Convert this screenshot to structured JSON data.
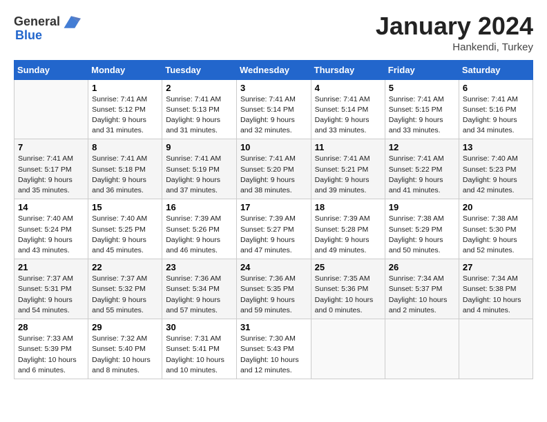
{
  "header": {
    "logo_general": "General",
    "logo_blue": "Blue",
    "month_title": "January 2024",
    "subtitle": "Hankendi, Turkey"
  },
  "columns": [
    "Sunday",
    "Monday",
    "Tuesday",
    "Wednesday",
    "Thursday",
    "Friday",
    "Saturday"
  ],
  "weeks": [
    [
      {
        "day": "",
        "sunrise": "",
        "sunset": "",
        "daylight": ""
      },
      {
        "day": "1",
        "sunrise": "Sunrise: 7:41 AM",
        "sunset": "Sunset: 5:12 PM",
        "daylight": "Daylight: 9 hours and 31 minutes."
      },
      {
        "day": "2",
        "sunrise": "Sunrise: 7:41 AM",
        "sunset": "Sunset: 5:13 PM",
        "daylight": "Daylight: 9 hours and 31 minutes."
      },
      {
        "day": "3",
        "sunrise": "Sunrise: 7:41 AM",
        "sunset": "Sunset: 5:14 PM",
        "daylight": "Daylight: 9 hours and 32 minutes."
      },
      {
        "day": "4",
        "sunrise": "Sunrise: 7:41 AM",
        "sunset": "Sunset: 5:14 PM",
        "daylight": "Daylight: 9 hours and 33 minutes."
      },
      {
        "day": "5",
        "sunrise": "Sunrise: 7:41 AM",
        "sunset": "Sunset: 5:15 PM",
        "daylight": "Daylight: 9 hours and 33 minutes."
      },
      {
        "day": "6",
        "sunrise": "Sunrise: 7:41 AM",
        "sunset": "Sunset: 5:16 PM",
        "daylight": "Daylight: 9 hours and 34 minutes."
      }
    ],
    [
      {
        "day": "7",
        "sunrise": "Sunrise: 7:41 AM",
        "sunset": "Sunset: 5:17 PM",
        "daylight": "Daylight: 9 hours and 35 minutes."
      },
      {
        "day": "8",
        "sunrise": "Sunrise: 7:41 AM",
        "sunset": "Sunset: 5:18 PM",
        "daylight": "Daylight: 9 hours and 36 minutes."
      },
      {
        "day": "9",
        "sunrise": "Sunrise: 7:41 AM",
        "sunset": "Sunset: 5:19 PM",
        "daylight": "Daylight: 9 hours and 37 minutes."
      },
      {
        "day": "10",
        "sunrise": "Sunrise: 7:41 AM",
        "sunset": "Sunset: 5:20 PM",
        "daylight": "Daylight: 9 hours and 38 minutes."
      },
      {
        "day": "11",
        "sunrise": "Sunrise: 7:41 AM",
        "sunset": "Sunset: 5:21 PM",
        "daylight": "Daylight: 9 hours and 39 minutes."
      },
      {
        "day": "12",
        "sunrise": "Sunrise: 7:41 AM",
        "sunset": "Sunset: 5:22 PM",
        "daylight": "Daylight: 9 hours and 41 minutes."
      },
      {
        "day": "13",
        "sunrise": "Sunrise: 7:40 AM",
        "sunset": "Sunset: 5:23 PM",
        "daylight": "Daylight: 9 hours and 42 minutes."
      }
    ],
    [
      {
        "day": "14",
        "sunrise": "Sunrise: 7:40 AM",
        "sunset": "Sunset: 5:24 PM",
        "daylight": "Daylight: 9 hours and 43 minutes."
      },
      {
        "day": "15",
        "sunrise": "Sunrise: 7:40 AM",
        "sunset": "Sunset: 5:25 PM",
        "daylight": "Daylight: 9 hours and 45 minutes."
      },
      {
        "day": "16",
        "sunrise": "Sunrise: 7:39 AM",
        "sunset": "Sunset: 5:26 PM",
        "daylight": "Daylight: 9 hours and 46 minutes."
      },
      {
        "day": "17",
        "sunrise": "Sunrise: 7:39 AM",
        "sunset": "Sunset: 5:27 PM",
        "daylight": "Daylight: 9 hours and 47 minutes."
      },
      {
        "day": "18",
        "sunrise": "Sunrise: 7:39 AM",
        "sunset": "Sunset: 5:28 PM",
        "daylight": "Daylight: 9 hours and 49 minutes."
      },
      {
        "day": "19",
        "sunrise": "Sunrise: 7:38 AM",
        "sunset": "Sunset: 5:29 PM",
        "daylight": "Daylight: 9 hours and 50 minutes."
      },
      {
        "day": "20",
        "sunrise": "Sunrise: 7:38 AM",
        "sunset": "Sunset: 5:30 PM",
        "daylight": "Daylight: 9 hours and 52 minutes."
      }
    ],
    [
      {
        "day": "21",
        "sunrise": "Sunrise: 7:37 AM",
        "sunset": "Sunset: 5:31 PM",
        "daylight": "Daylight: 9 hours and 54 minutes."
      },
      {
        "day": "22",
        "sunrise": "Sunrise: 7:37 AM",
        "sunset": "Sunset: 5:32 PM",
        "daylight": "Daylight: 9 hours and 55 minutes."
      },
      {
        "day": "23",
        "sunrise": "Sunrise: 7:36 AM",
        "sunset": "Sunset: 5:34 PM",
        "daylight": "Daylight: 9 hours and 57 minutes."
      },
      {
        "day": "24",
        "sunrise": "Sunrise: 7:36 AM",
        "sunset": "Sunset: 5:35 PM",
        "daylight": "Daylight: 9 hours and 59 minutes."
      },
      {
        "day": "25",
        "sunrise": "Sunrise: 7:35 AM",
        "sunset": "Sunset: 5:36 PM",
        "daylight": "Daylight: 10 hours and 0 minutes."
      },
      {
        "day": "26",
        "sunrise": "Sunrise: 7:34 AM",
        "sunset": "Sunset: 5:37 PM",
        "daylight": "Daylight: 10 hours and 2 minutes."
      },
      {
        "day": "27",
        "sunrise": "Sunrise: 7:34 AM",
        "sunset": "Sunset: 5:38 PM",
        "daylight": "Daylight: 10 hours and 4 minutes."
      }
    ],
    [
      {
        "day": "28",
        "sunrise": "Sunrise: 7:33 AM",
        "sunset": "Sunset: 5:39 PM",
        "daylight": "Daylight: 10 hours and 6 minutes."
      },
      {
        "day": "29",
        "sunrise": "Sunrise: 7:32 AM",
        "sunset": "Sunset: 5:40 PM",
        "daylight": "Daylight: 10 hours and 8 minutes."
      },
      {
        "day": "30",
        "sunrise": "Sunrise: 7:31 AM",
        "sunset": "Sunset: 5:41 PM",
        "daylight": "Daylight: 10 hours and 10 minutes."
      },
      {
        "day": "31",
        "sunrise": "Sunrise: 7:30 AM",
        "sunset": "Sunset: 5:43 PM",
        "daylight": "Daylight: 10 hours and 12 minutes."
      },
      {
        "day": "",
        "sunrise": "",
        "sunset": "",
        "daylight": ""
      },
      {
        "day": "",
        "sunrise": "",
        "sunset": "",
        "daylight": ""
      },
      {
        "day": "",
        "sunrise": "",
        "sunset": "",
        "daylight": ""
      }
    ]
  ]
}
